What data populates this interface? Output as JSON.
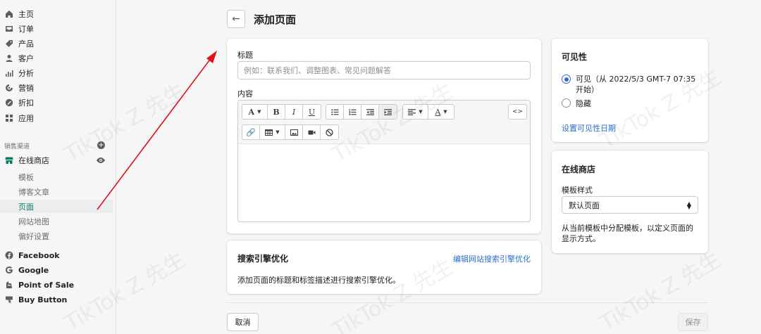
{
  "sidebar": {
    "nav": [
      {
        "label": "主页",
        "icon": "home-icon"
      },
      {
        "label": "订单",
        "icon": "orders-icon"
      },
      {
        "label": "产品",
        "icon": "tag-icon"
      },
      {
        "label": "客户",
        "icon": "person-icon"
      },
      {
        "label": "分析",
        "icon": "analytics-icon"
      },
      {
        "label": "营销",
        "icon": "marketing-icon"
      },
      {
        "label": "折扣",
        "icon": "discount-icon"
      },
      {
        "label": "应用",
        "icon": "apps-icon"
      }
    ],
    "sales_channels_label": "销售渠道",
    "online_store": "在线商店",
    "sub_items": [
      "模板",
      "博客文章",
      "页面",
      "网站地图",
      "偏好设置"
    ],
    "active_sub": "页面",
    "channels": [
      {
        "label": "Facebook",
        "icon": "facebook-icon"
      },
      {
        "label": "Google",
        "icon": "google-icon"
      },
      {
        "label": "Point of Sale",
        "icon": "pos-icon"
      },
      {
        "label": "Buy Button",
        "icon": "buy-button-icon"
      }
    ]
  },
  "header": {
    "title": "添加页面"
  },
  "main_card": {
    "title_label": "标题",
    "title_placeholder": "例如：联系我们、调整图表、常见问题解答",
    "content_label": "内容"
  },
  "seo": {
    "title": "搜索引擎优化",
    "edit_link": "编辑网站搜索引擎优化",
    "description": "添加页面的标题和标签描述进行搜索引擎优化。"
  },
  "visibility": {
    "title": "可见性",
    "visible_label": "可见（从 2022/5/3 GMT-7 07:35 开始）",
    "hidden_label": "隐藏",
    "set_date_link": "设置可见性日期",
    "selected": "visible"
  },
  "online_store_card": {
    "title": "在线商店",
    "template_label": "模板样式",
    "template_value": "默认页面",
    "help": "从当前模板中分配模板，以定义页面的显示方式。"
  },
  "footer": {
    "cancel": "取消",
    "save": "保存"
  },
  "watermark_text": "TikTok Z 先生",
  "colors": {
    "accent_green": "#008060",
    "link_blue": "#2c6ecb",
    "annotation_red": "#e0111b"
  }
}
